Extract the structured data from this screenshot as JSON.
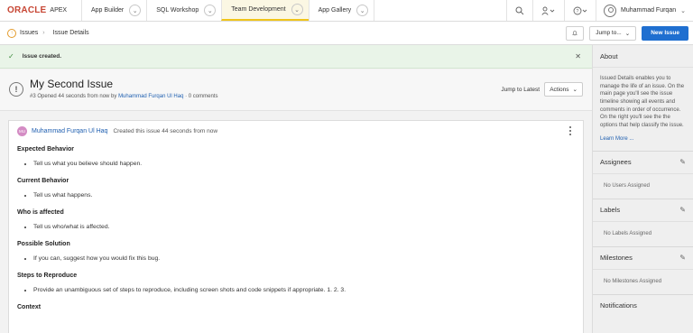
{
  "brand": {
    "name": "ORACLE",
    "product": "APEX"
  },
  "nav": {
    "tabs": [
      {
        "label": "App Builder"
      },
      {
        "label": "SQL Workshop"
      },
      {
        "label": "Team Development",
        "active": true
      },
      {
        "label": "App Gallery"
      }
    ],
    "user": "Muhammad Furqan"
  },
  "breadcrumb": {
    "items": [
      "Issues",
      "Issue Details"
    ]
  },
  "toolbar": {
    "jump_to": "Jump to...",
    "new_issue": "New Issue"
  },
  "alert": {
    "message": "Issue created."
  },
  "issue": {
    "title": "My Second Issue",
    "meta_prefix": "#3 Opened 44 seconds from now by ",
    "author": "Muhammad Furqan Ul Haq",
    "meta_suffix": " · 0 comments",
    "jump_to_latest": "Jump to Latest",
    "actions": "Actions"
  },
  "comment": {
    "avatar_initials": "MU",
    "author": "Muhammad Furqan Ul Haq",
    "created": "Created this issue 44 seconds from now",
    "sections": [
      {
        "heading": "Expected Behavior",
        "items": [
          "Tell us what you believe should happen."
        ]
      },
      {
        "heading": "Current Behavior",
        "items": [
          "Tell us what happens."
        ]
      },
      {
        "heading": "Who is affected",
        "items": [
          "Tell us who/what is affected."
        ]
      },
      {
        "heading": "Possible Solution",
        "items": [
          "If you can, suggest how you would fix this bug."
        ]
      },
      {
        "heading": "Steps to Reproduce",
        "items": [
          "Provide an unambiguous set of steps to reproduce, including screen shots and code snippets if appropriate. 1. 2. 3."
        ]
      },
      {
        "heading": "Context",
        "items": []
      }
    ]
  },
  "sidebar": {
    "about": {
      "title": "About",
      "text": "Issued Details enables you to manage the life of an issue. On the main page you'll see the issue timeline showing all events and comments in order of occurrence. On the right you'll see the the options that help classify the issue.",
      "learn_more": "Learn More ..."
    },
    "assignees": {
      "title": "Assignees",
      "empty": "No Users Assigned"
    },
    "labels": {
      "title": "Labels",
      "empty": "No Labels Assigned"
    },
    "milestones": {
      "title": "Milestones",
      "empty": "No Milestones Assigned"
    },
    "notifications": {
      "title": "Notifications"
    }
  }
}
